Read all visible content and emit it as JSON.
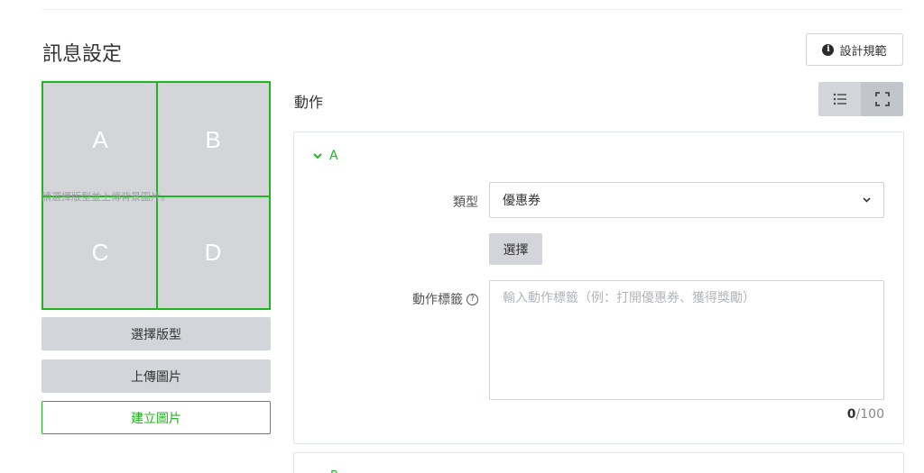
{
  "header": {
    "title": "訊息設定",
    "design_button": "設計規範",
    "info_glyph": "i"
  },
  "grid": {
    "cells": [
      "A",
      "B",
      "C",
      "D"
    ],
    "hint": "請選擇版型並上傳背景圖片。",
    "accent_color": "#1fb51f"
  },
  "sidebar": {
    "select_layout": "選擇版型",
    "upload_image": "上傳圖片",
    "create_image": "建立圖片"
  },
  "actions": {
    "title": "動作",
    "view_toggle": [
      "list-icon",
      "fullscreen-icon"
    ],
    "panel_a": {
      "label": "A",
      "type_label": "類型",
      "type_value": "優惠券",
      "choose_button": "選擇",
      "tag_label": "動作標籤",
      "help_glyph": "?",
      "tag_placeholder": "輸入動作標籤（例：打開優惠券、獲得獎勵）",
      "counter_current": "0",
      "counter_max": "/100"
    },
    "panel_b": {
      "label": "B"
    }
  }
}
